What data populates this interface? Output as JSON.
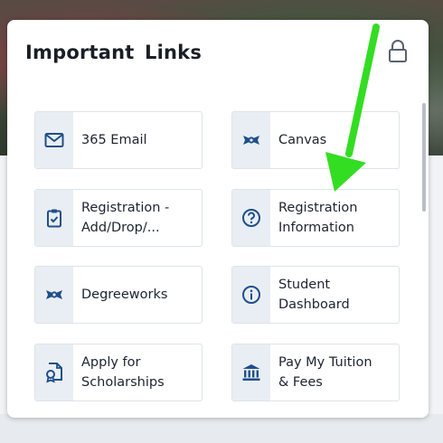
{
  "widget": {
    "title": "Important Links"
  },
  "links": [
    {
      "label": "365 Email"
    },
    {
      "label": "Canvas"
    },
    {
      "label": "Registration -\nAdd/Drop/..."
    },
    {
      "label": "Registration\nInformation"
    },
    {
      "label": "Degreeworks"
    },
    {
      "label": "Student\nDashboard"
    },
    {
      "label": "Apply for\nScholarships"
    },
    {
      "label": "Pay My Tuition\n& Fees"
    }
  ],
  "icons": {
    "365 Email": "envelope-icon",
    "Canvas": "graduation-ribbon-icon",
    "Registration - Add/Drop/...": "clipboard-check-icon",
    "Registration Information": "question-circle-icon",
    "Degreeworks": "graduation-ribbon-icon",
    "Student Dashboard": "info-circle-icon",
    "Apply for Scholarships": "certificate-icon",
    "Pay My Tuition & Fees": "bank-icon"
  },
  "colors": {
    "icon": "#1f4f8a",
    "tile_icon_bg": "#e9eef4",
    "annotation_arrow": "#33dd22"
  }
}
